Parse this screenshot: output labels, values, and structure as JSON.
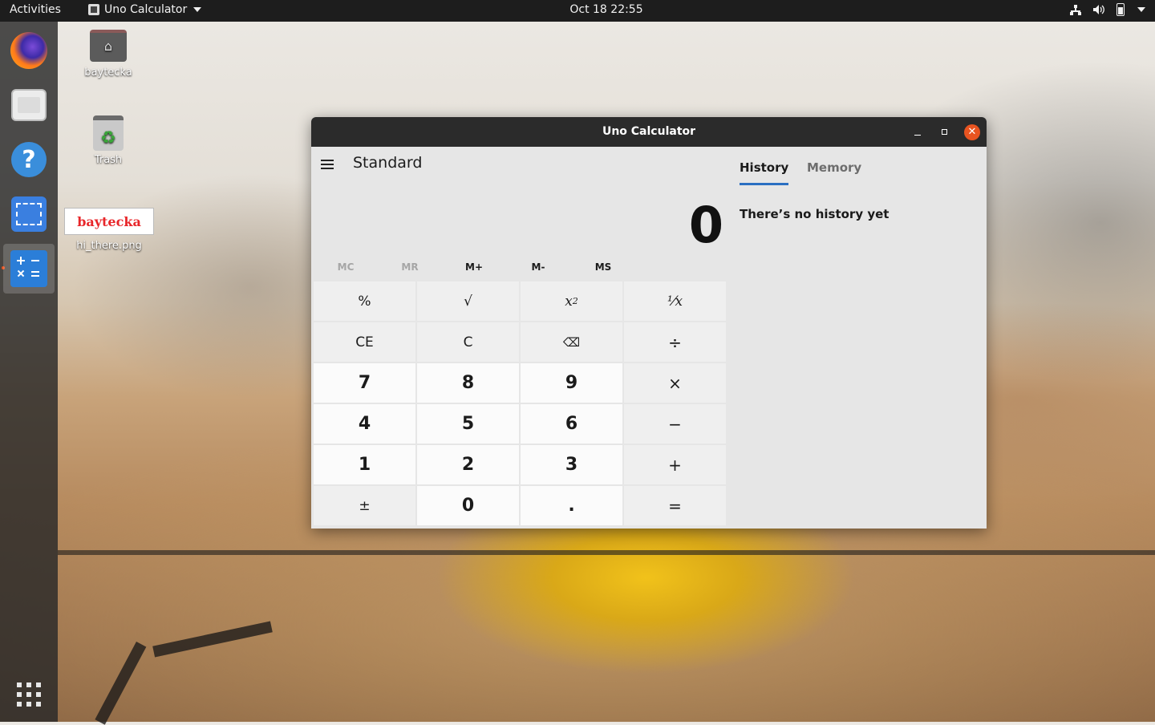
{
  "topbar": {
    "activities": "Activities",
    "app_name": "Uno Calculator",
    "clock": "Oct 18  22:55"
  },
  "dock": {
    "items": [
      "firefox",
      "files",
      "help",
      "screenshot",
      "uno-calculator",
      "show-applications"
    ]
  },
  "desktop": {
    "icons": [
      {
        "label": "baytecka"
      },
      {
        "label": "Trash"
      },
      {
        "label": "hi_there.png",
        "thumbnail_text": "baytecka"
      }
    ]
  },
  "window": {
    "title": "Uno Calculator",
    "mode": "Standard",
    "display_value": "0",
    "tabs": {
      "history": "History",
      "memory": "Memory"
    },
    "history_empty": "There’s no history yet",
    "memory_buttons": [
      {
        "label": "MC",
        "enabled": false
      },
      {
        "label": "MR",
        "enabled": false
      },
      {
        "label": "M+",
        "enabled": true
      },
      {
        "label": "M-",
        "enabled": true
      },
      {
        "label": "MS",
        "enabled": true
      }
    ],
    "keys": {
      "percent": "%",
      "sqrt": "√",
      "square_base": "x",
      "square_exp": "2",
      "reciprocal": "¹⁄x",
      "ce": "CE",
      "c": "C",
      "backspace": "⌫",
      "divide": "÷",
      "d7": "7",
      "d8": "8",
      "d9": "9",
      "multiply": "×",
      "d4": "4",
      "d5": "5",
      "d6": "6",
      "minus": "−",
      "d1": "1",
      "d2": "2",
      "d3": "3",
      "plus": "+",
      "negate": "±",
      "d0": "0",
      "decimal": ".",
      "equals": "="
    }
  },
  "colors": {
    "accent": "#2b6fc2",
    "close_button": "#e95420",
    "titlebar": "#2b2b2b"
  }
}
